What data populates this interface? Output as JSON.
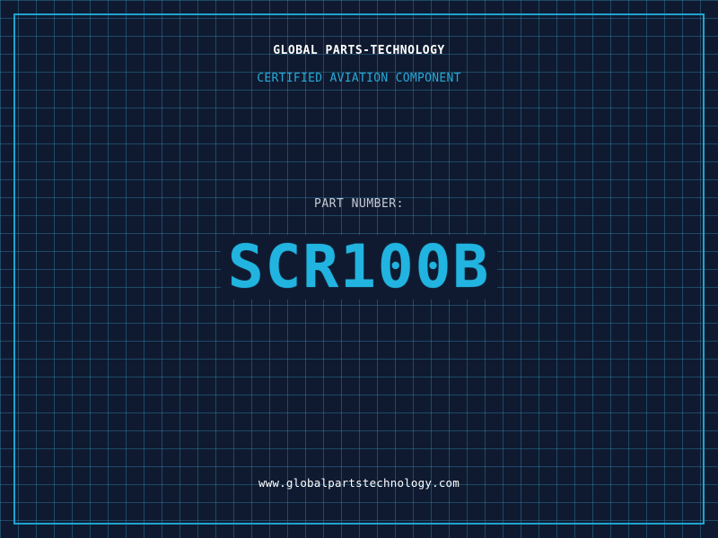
{
  "header": {
    "company": "GLOBAL PARTS-TECHNOLOGY",
    "subtitle": "CERTIFIED AVIATION COMPONENT"
  },
  "part": {
    "label": "PART NUMBER:",
    "number": "SCR100B"
  },
  "footer": {
    "website": "www.globalpartstechnology.com"
  },
  "colors": {
    "background": "#0f1a30",
    "grid": "#2a6f8e",
    "accent": "#22b4e0",
    "frame": "#1fa3cf",
    "text": "#ffffff"
  }
}
